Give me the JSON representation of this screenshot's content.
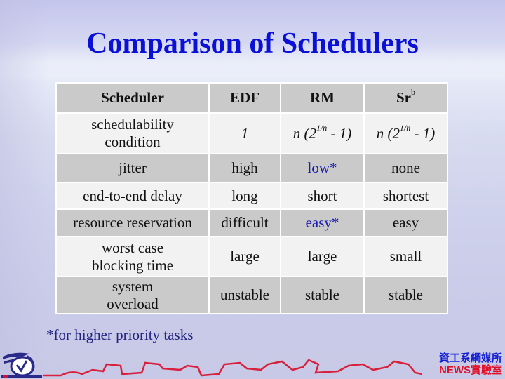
{
  "slide": {
    "title": "Comparison of Schedulers",
    "footnote": "*for higher priority tasks",
    "lab_logo": {
      "line1": "資工系網媒所",
      "line2": "NEWS實驗室"
    },
    "colors": {
      "title": "#0a10d6",
      "highlight": "#1a1ab0",
      "row_dark": "#cacaca",
      "row_light": "#f2f2f2",
      "footnote": "#232382",
      "lab_line1": "#1520d0",
      "lab_line2": "#e0102a"
    }
  },
  "table": {
    "header": {
      "c0": "Scheduler",
      "c1": "EDF",
      "c2": "RM",
      "c3_base": "Sr",
      "c3_sup": "b"
    },
    "rows": [
      {
        "label": "schedulability condition",
        "label_l1": "schedulability",
        "label_l2": "condition",
        "edf": "1",
        "rm_pre": "n (2",
        "rm_sup": "1/n",
        "rm_post": " - 1)",
        "sr_pre": "n (2",
        "sr_sup": "1/n",
        "sr_post": " - 1)"
      },
      {
        "label": "jitter",
        "edf": "high",
        "rm": "low*",
        "sr": "none",
        "rm_highlight": true
      },
      {
        "label": "end-to-end delay",
        "edf": "long",
        "rm": "short",
        "sr": "shortest"
      },
      {
        "label": "resource reservation",
        "edf": "difficult",
        "rm": "easy*",
        "sr": "easy",
        "rm_highlight": true
      },
      {
        "label": "worst case blocking time",
        "label_l1": "worst case",
        "label_l2": "blocking time",
        "edf": "large",
        "rm": "large",
        "sr": "small"
      },
      {
        "label": "system overload",
        "label_l1": "system",
        "label_l2": "overload",
        "edf": "unstable",
        "rm": "stable",
        "sr": "stable"
      }
    ]
  }
}
